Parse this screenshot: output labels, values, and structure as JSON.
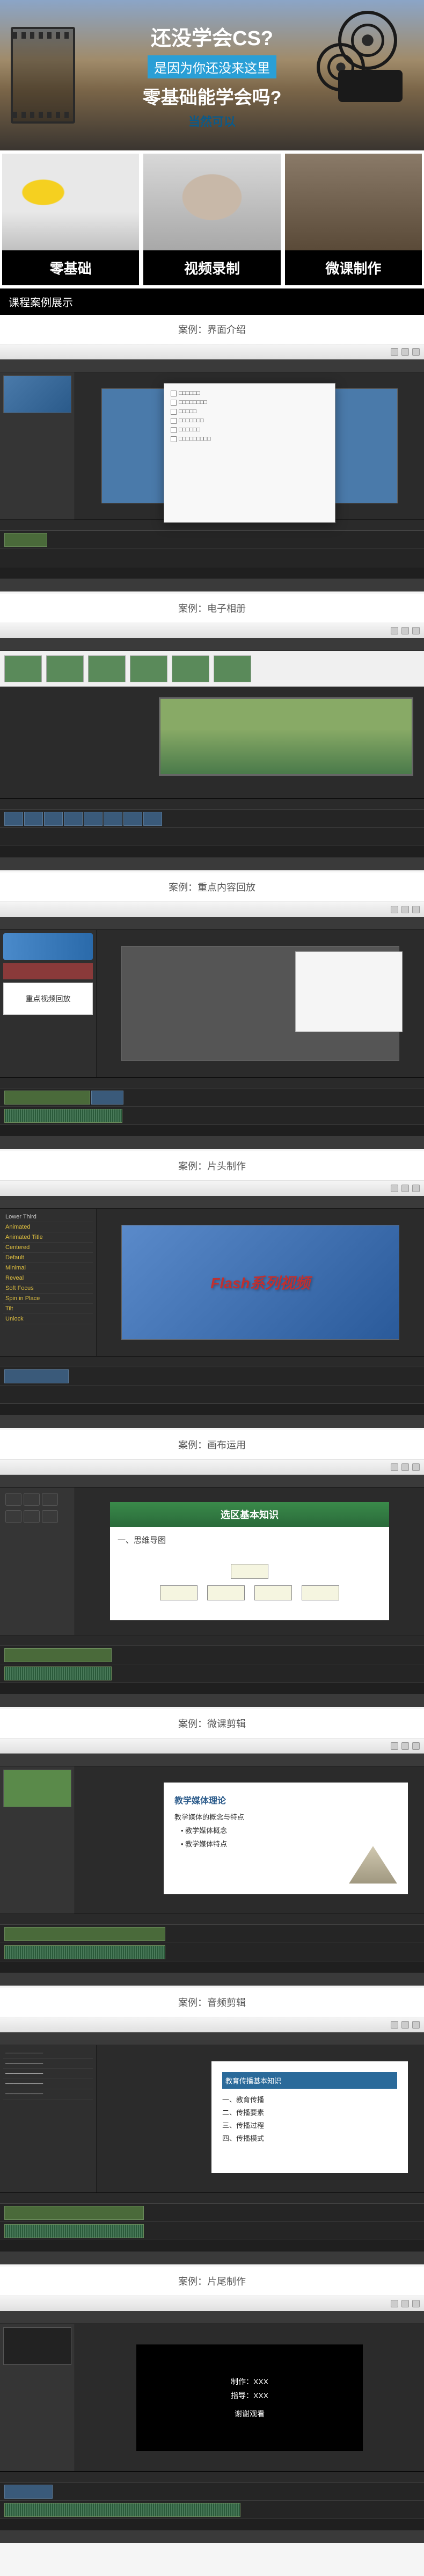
{
  "hero": {
    "line1_prefix": "还没学会",
    "line1_cs": "CS",
    "line1_suffix": "?",
    "line2": "是因为你还没来这里",
    "line3": "零基础能学会吗?",
    "line4": "当然可以"
  },
  "features": [
    {
      "label": "零基础"
    },
    {
      "label": "视频录制"
    },
    {
      "label": "微课制作"
    }
  ],
  "sectionTitle": "课程案例展示",
  "cases": [
    {
      "title": "案例：界面介绍"
    },
    {
      "title": "案例：电子相册"
    },
    {
      "title": "案例：重点内容回放"
    },
    {
      "title": "案例：片头制作"
    },
    {
      "title": "案例：画布运用"
    },
    {
      "title": "案例：微课剪辑"
    },
    {
      "title": "案例：音频剪辑"
    },
    {
      "title": "案例：片尾制作"
    }
  ],
  "case3": {
    "replayLabel": "重点视频回放"
  },
  "case4": {
    "flashText": "Flash系列视频",
    "panelItems": [
      "Lower Third",
      "Animated",
      "Animated Title",
      "Centered",
      "Default",
      "Minimal",
      "Reveal",
      "Soft Focus",
      "Spin in Place",
      "Tilt",
      "Unlock"
    ]
  },
  "case5": {
    "slideTitle": "选区基本知识",
    "subTitle": "一、思维导图"
  },
  "case6": {
    "slideTitle": "教学媒体理论",
    "bullets": [
      "教学媒体的概念与特点",
      "• 教学媒体概念",
      "• 教学媒体特点"
    ]
  },
  "case7": {
    "slideTitle": "教育传播基本知识",
    "items": [
      "一、教育传播",
      "二、传播要素",
      "三、传播过程",
      "四、传播模式"
    ]
  },
  "case8": {
    "lines": [
      "制作：XXX",
      "指导：XXX",
      "谢谢观看"
    ]
  }
}
